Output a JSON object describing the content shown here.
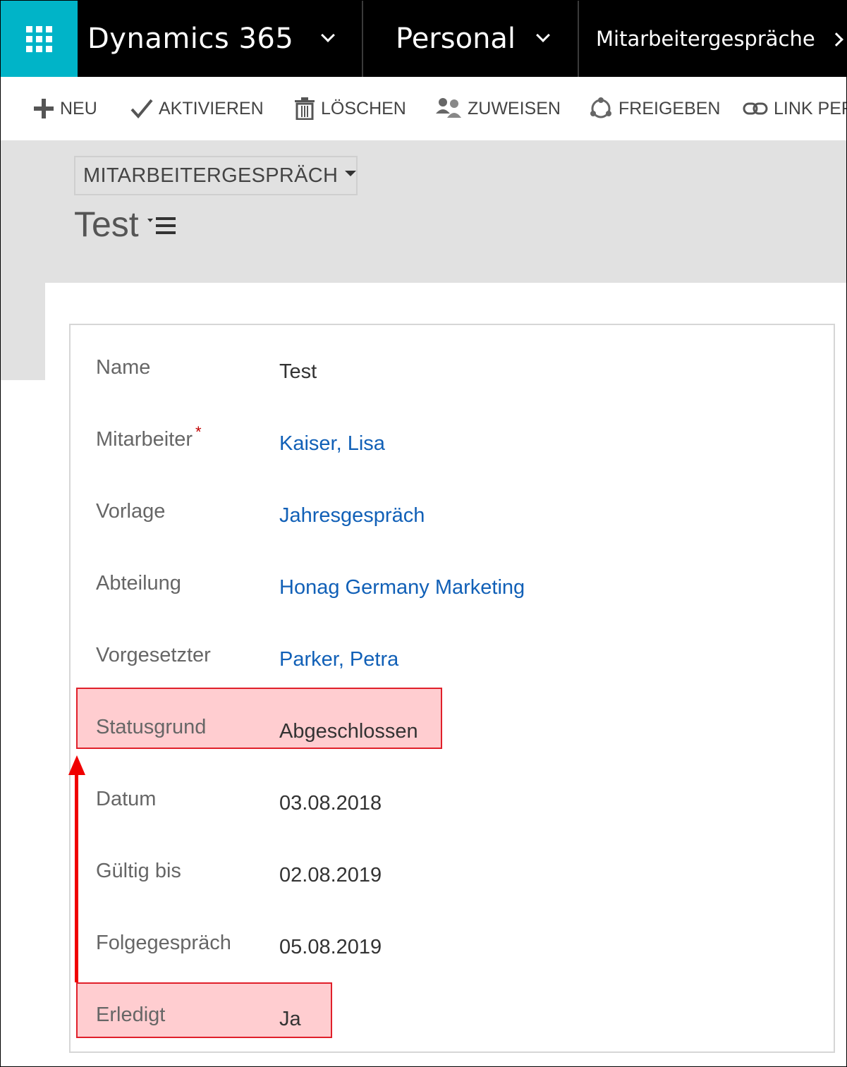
{
  "nav": {
    "app_name": "Dynamics 365",
    "area": "Personal",
    "entity": "Mitarbeitergespräche"
  },
  "commands": {
    "neu": "NEU",
    "aktivieren": "AKTIVIEREN",
    "loeschen": "LÖSCHEN",
    "zuweisen": "ZUWEISEN",
    "freigeben": "FREIGEBEN",
    "link": "LINK PER"
  },
  "header": {
    "form_selector": "MITARBEITERGESPRÄCH",
    "record_title": "Test"
  },
  "fields": {
    "name": {
      "label": "Name",
      "value": "Test"
    },
    "mitarbeiter": {
      "label": "Mitarbeiter",
      "required_mark": "*",
      "value": "Kaiser, Lisa"
    },
    "vorlage": {
      "label": "Vorlage",
      "value": "Jahresgespräch"
    },
    "abteilung": {
      "label": "Abteilung",
      "value": "Honag Germany Marketing"
    },
    "vorgesetzter": {
      "label": "Vorgesetzter",
      "value": "Parker, Petra"
    },
    "statusgrund": {
      "label": "Statusgrund",
      "value": "Abgeschlossen"
    },
    "datum": {
      "label": "Datum",
      "value": "03.08.2018"
    },
    "gueltig_bis": {
      "label": "Gültig bis",
      "value": "02.08.2019"
    },
    "folgegespraech": {
      "label": "Folgegespräch",
      "value": "05.08.2019"
    },
    "erledigt": {
      "label": "Erledigt",
      "value": "Ja"
    }
  },
  "colors": {
    "nav_bg": "#000000",
    "waffle_bg": "#00b4c8",
    "link": "#1160b7",
    "highlight_fill": "#ffcdd0",
    "highlight_border": "#e0202a",
    "arrow": "#f00000"
  }
}
